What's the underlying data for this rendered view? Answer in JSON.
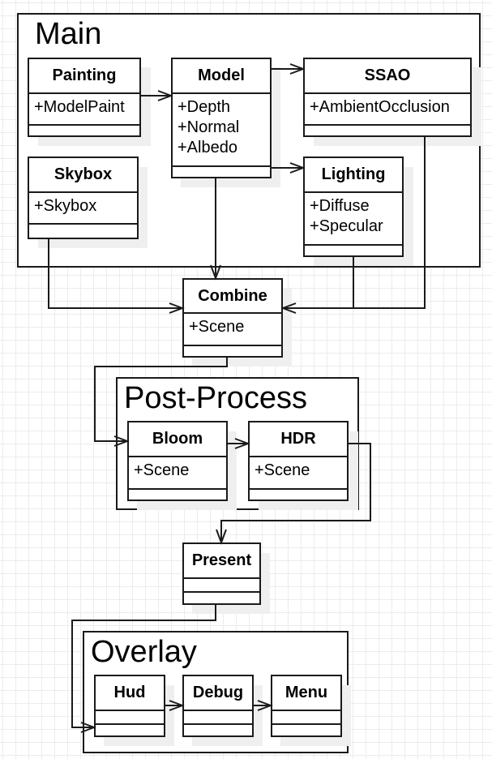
{
  "groups": {
    "main": {
      "title": "Main"
    },
    "post_process": {
      "title": "Post-Process"
    },
    "overlay": {
      "title": "Overlay"
    }
  },
  "classes": {
    "painting": {
      "name": "Painting",
      "attributes": [
        "+ModelPaint"
      ]
    },
    "model": {
      "name": "Model",
      "attributes": [
        "+Depth",
        "+Normal",
        "+Albedo"
      ]
    },
    "ssao": {
      "name": "SSAO",
      "attributes": [
        "+AmbientOcclusion"
      ]
    },
    "skybox": {
      "name": "Skybox",
      "attributes": [
        "+Skybox"
      ]
    },
    "lighting": {
      "name": "Lighting",
      "attributes": [
        "+Diffuse",
        "+Specular"
      ]
    },
    "combine": {
      "name": "Combine",
      "attributes": [
        "+Scene"
      ]
    },
    "bloom": {
      "name": "Bloom",
      "attributes": [
        "+Scene"
      ]
    },
    "hdr": {
      "name": "HDR",
      "attributes": [
        "+Scene"
      ]
    },
    "present": {
      "name": "Present",
      "attributes": []
    },
    "hud": {
      "name": "Hud",
      "attributes": []
    },
    "debug": {
      "name": "Debug",
      "attributes": []
    },
    "menu": {
      "name": "Menu",
      "attributes": []
    }
  },
  "connections": [
    {
      "from": "Painting",
      "to": "Model"
    },
    {
      "from": "Model",
      "to": "SSAO"
    },
    {
      "from": "Model",
      "to": "Lighting"
    },
    {
      "from": "Model",
      "to": "Combine"
    },
    {
      "from": "Skybox",
      "to": "Combine"
    },
    {
      "from": "Lighting",
      "to": "Combine"
    },
    {
      "from": "SSAO",
      "to": "Combine"
    },
    {
      "from": "Combine",
      "to": "Bloom"
    },
    {
      "from": "Bloom",
      "to": "HDR"
    },
    {
      "from": "HDR",
      "to": "Present"
    },
    {
      "from": "Present",
      "to": "Hud"
    },
    {
      "from": "Hud",
      "to": "Debug"
    },
    {
      "from": "Debug",
      "to": "Menu"
    }
  ]
}
